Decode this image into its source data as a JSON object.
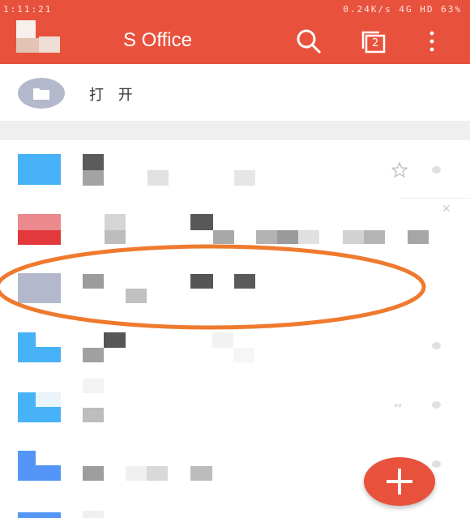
{
  "status_bar": {
    "time": "1:11:21",
    "right_text": "0.24K/s  4G HD  63%"
  },
  "app_bar": {
    "title": "S Office",
    "icons": [
      "logo-icon",
      "search-icon",
      "tabs-icon",
      "more-vert-icon"
    ],
    "tab_count": "2"
  },
  "open_row": {
    "label": "打 开",
    "icon": "folder-icon"
  },
  "files": [
    {
      "icon_color": "#47b2f7",
      "icon_type": "doc",
      "starred": false
    },
    {
      "icon_color": "#e3383c",
      "icon_type": "pdf",
      "starred": false
    },
    {
      "icon_color": "#b4b8cc",
      "icon_type": "blank",
      "starred": false
    },
    {
      "icon_color": "#47b2f7",
      "icon_type": "doc",
      "starred": false
    },
    {
      "icon_color": "#47b2f7",
      "icon_type": "doc",
      "starred": false
    },
    {
      "icon_color": "#5496f7",
      "icon_type": "doc",
      "starred": false
    }
  ],
  "fab": {
    "icon": "plus-icon"
  },
  "annotation": {
    "color": "#ef7a2f",
    "shape": "ellipse"
  },
  "colors": {
    "brand": "#e8523c",
    "annotation": "#ef7a2f"
  }
}
